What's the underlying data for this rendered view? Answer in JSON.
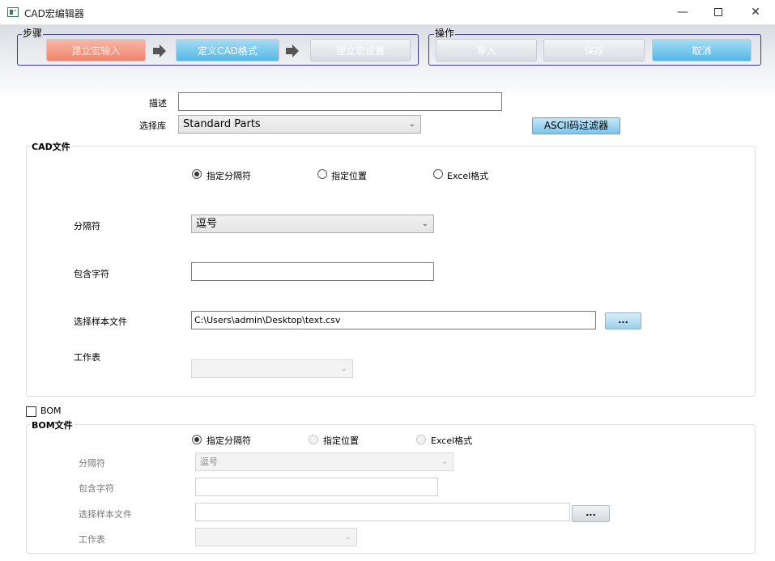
{
  "window": {
    "title": "CAD宏编辑器",
    "minimize_glyph": "—",
    "close_glyph": "✕"
  },
  "steps_group": {
    "label": "步骤",
    "items": [
      {
        "label": "建立宏输入",
        "state": "active-red"
      },
      {
        "label": "定义CAD格式",
        "state": "current-blue"
      },
      {
        "label": "建立宏设置",
        "state": "disabled-gray"
      }
    ]
  },
  "actions_group": {
    "label": "操作",
    "import_label": "导入",
    "save_label": "保存",
    "cancel_label": "取消"
  },
  "form": {
    "description_label": "描述",
    "description_value": "",
    "library_label": "选择库",
    "library_value": "Standard Parts",
    "ascii_filter_label": "ASCII码过滤器"
  },
  "cad_file": {
    "title": "CAD文件",
    "radio_options": [
      {
        "label": "指定分隔符",
        "selected": true
      },
      {
        "label": "指定位置",
        "selected": false
      },
      {
        "label": "Excel格式",
        "selected": false
      }
    ],
    "delimiter_label": "分隔符",
    "delimiter_value": "逗号",
    "include_chars_label": "包含字符",
    "include_chars_value": "",
    "sample_file_label": "选择样本文件",
    "sample_file_value": "C:\\Users\\admin\\Desktop\\text.csv",
    "browse_label": "...",
    "worksheet_label": "工作表",
    "worksheet_value": ""
  },
  "bom": {
    "checkbox_label": "BOM",
    "checked": false,
    "title": "BOM文件",
    "radio_options": [
      {
        "label": "指定分隔符",
        "selected": true
      },
      {
        "label": "指定位置",
        "selected": false
      },
      {
        "label": "Excel格式",
        "selected": false
      }
    ],
    "delimiter_label": "分隔符",
    "delimiter_value": "逗号",
    "include_chars_label": "包含字符",
    "include_chars_value": "",
    "sample_file_label": "选择样本文件",
    "sample_file_value": "",
    "browse_label": "...",
    "worksheet_label": "工作表",
    "worksheet_value": ""
  },
  "colors": {
    "group_border": "#3d3a8c",
    "step_active": "#ee866d",
    "step_current": "#55b8e6",
    "button_blue": "#55b8e6"
  }
}
